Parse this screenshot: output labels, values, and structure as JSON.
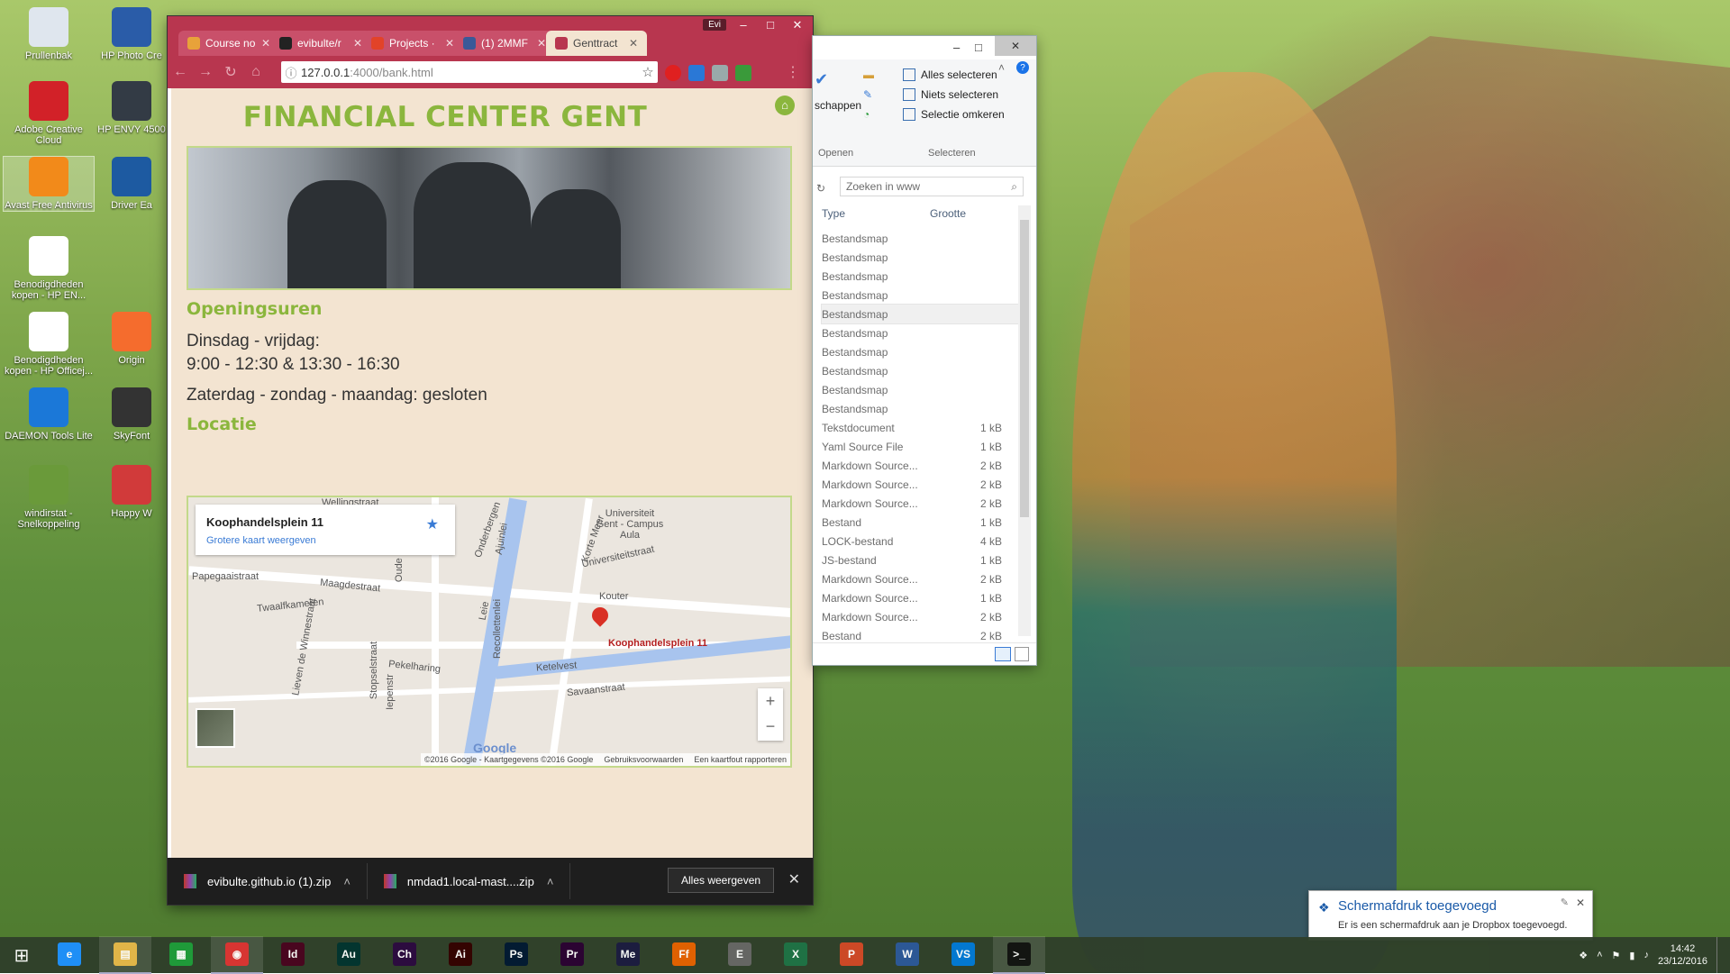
{
  "desktop_icons": [
    {
      "label": "Prullenbak",
      "color": "#dfe6ee"
    },
    {
      "label": "HP Photo Cre",
      "color": "#2a5ca8"
    },
    {
      "label": "Adobe Creative Cloud",
      "color": "#d22128"
    },
    {
      "label": "HP ENVY 4500",
      "color": "#333b45"
    },
    {
      "label": "Avast Free Antivirus",
      "color": "#f28a1a"
    },
    {
      "label": "Driver Ea",
      "color": "#1d5aa1"
    },
    {
      "label": "Benodigdheden kopen - HP EN...",
      "color": "#ffffff"
    },
    {
      "label": "Benodigdheden kopen - HP Officej...",
      "color": "#ffffff"
    },
    {
      "label": "Origin",
      "color": "#f56c2d"
    },
    {
      "label": "DAEMON Tools Lite",
      "color": "#1b78d8"
    },
    {
      "label": "SkyFont",
      "color": "#333"
    },
    {
      "label": "windirstat - Snelkoppeling",
      "color": "#6a9a3a"
    },
    {
      "label": "Happy W",
      "color": "#d13a3a"
    }
  ],
  "browser": {
    "profile": "Evi",
    "tabs": [
      {
        "label": "Course no",
        "color": "#e8a23a"
      },
      {
        "label": "evibulte/r",
        "color": "#222"
      },
      {
        "label": "Projects ·",
        "color": "#e24329"
      },
      {
        "label": "(1) 2MMF",
        "color": "#3b5998"
      },
      {
        "label": "Genttract",
        "color": "#b8364f",
        "active": true
      }
    ],
    "url_host": "127.0.0.1",
    "url_path": ":4000/bank.html"
  },
  "page": {
    "title": "FINANCIAL CENTER GENT",
    "hours_heading": "Openingsuren",
    "hours_line1": "Dinsdag - vrijdag:",
    "hours_line2": "9:00 - 12:30 & 13:30 - 16:30",
    "hours_line3": "Zaterdag - zondag - maandag: gesloten",
    "location_heading": "Locatie",
    "map": {
      "place": "Koophandelsplein 11",
      "bigger_map": "Grotere kaart weergeven",
      "pin_label": "Koophandelsplein 11",
      "labels": [
        "Papegaaistraat",
        "Maagdestraat",
        "Twaalfkameren",
        "Onderbergen",
        "Kouter",
        "Ketelvest",
        "Pekelharing",
        "Savaanstraat",
        "Universiteit Gent - Campus Aula",
        "Universiteitstraat",
        "Korte Meer",
        "Recollettenlei",
        "Leie",
        "Stopselstraat",
        "Lieven de Winnestraat",
        "Oude Houtlei",
        "Wellingstraat",
        "Ajuinlei",
        "Iepenstr"
      ],
      "footer": [
        "©2016 Google - Kaartgegevens ©2016 Google",
        "Gebruiksvoorwaarden",
        "Een kaartfout rapporteren"
      ],
      "google": "Google"
    }
  },
  "downloads": {
    "items": [
      "evibulte.github.io (1).zip",
      "nmdad1.local-mast....zip"
    ],
    "show_all": "Alles weergeven"
  },
  "explorer": {
    "ribbon": {
      "schappen": "schappen",
      "openen": "Openen",
      "select_all": "Alles selecteren",
      "select_none": "Niets selecteren",
      "invert": "Selectie omkeren",
      "selecteren": "Selecteren"
    },
    "search_placeholder": "Zoeken in www",
    "col_type": "Type",
    "col_size": "Grootte",
    "rows": [
      {
        "type": "Bestandsmap",
        "size": ""
      },
      {
        "type": "Bestandsmap",
        "size": ""
      },
      {
        "type": "Bestandsmap",
        "size": ""
      },
      {
        "type": "Bestandsmap",
        "size": ""
      },
      {
        "type": "Bestandsmap",
        "size": ""
      },
      {
        "type": "Bestandsmap",
        "size": ""
      },
      {
        "type": "Bestandsmap",
        "size": ""
      },
      {
        "type": "Bestandsmap",
        "size": ""
      },
      {
        "type": "Bestandsmap",
        "size": ""
      },
      {
        "type": "Bestandsmap",
        "size": ""
      },
      {
        "type": "Tekstdocument",
        "size": "1 kB"
      },
      {
        "type": "Yaml Source File",
        "size": "1 kB"
      },
      {
        "type": "Markdown Source...",
        "size": "2 kB"
      },
      {
        "type": "Markdown Source...",
        "size": "2 kB"
      },
      {
        "type": "Markdown Source...",
        "size": "2 kB"
      },
      {
        "type": "Bestand",
        "size": "1 kB"
      },
      {
        "type": "LOCK-bestand",
        "size": "4 kB"
      },
      {
        "type": "JS-bestand",
        "size": "1 kB"
      },
      {
        "type": "Markdown Source...",
        "size": "2 kB"
      },
      {
        "type": "Markdown Source...",
        "size": "1 kB"
      },
      {
        "type": "Markdown Source...",
        "size": "2 kB"
      },
      {
        "type": "Bestand",
        "size": "2 kB"
      }
    ]
  },
  "notification": {
    "title": "Schermafdruk toegevoegd",
    "text": "Er is een schermafdruk aan je Dropbox toegevoegd."
  },
  "taskbar": {
    "apps": [
      {
        "name": "ie",
        "label": "e",
        "color": "#1e90ff"
      },
      {
        "name": "explorer",
        "label": "▤",
        "color": "#e6b84a",
        "open": true
      },
      {
        "name": "store",
        "label": "▦",
        "color": "#1e9c3a"
      },
      {
        "name": "chrome",
        "label": "◉",
        "color": "#d33",
        "open": true
      },
      {
        "name": "indesign",
        "label": "Id",
        "color": "#49021f"
      },
      {
        "name": "audition",
        "label": "Au",
        "color": "#00332f"
      },
      {
        "name": "character",
        "label": "Ch",
        "color": "#2b0840"
      },
      {
        "name": "illustrator",
        "label": "Ai",
        "color": "#330000"
      },
      {
        "name": "photoshop",
        "label": "Ps",
        "color": "#001833"
      },
      {
        "name": "premiere",
        "label": "Pr",
        "color": "#2a0033"
      },
      {
        "name": "media-encoder",
        "label": "Me",
        "color": "#1a1a40"
      },
      {
        "name": "firefox",
        "label": "Ff",
        "color": "#e66000"
      },
      {
        "name": "evernote",
        "label": "E",
        "color": "#666"
      },
      {
        "name": "excel",
        "label": "X",
        "color": "#1e7145"
      },
      {
        "name": "powerpoint",
        "label": "P",
        "color": "#d24726"
      },
      {
        "name": "word",
        "label": "W",
        "color": "#2b579a"
      },
      {
        "name": "vscode",
        "label": "VS",
        "color": "#0078d7"
      },
      {
        "name": "cmd",
        "label": ">_",
        "color": "#111",
        "open": true
      }
    ],
    "time": "14:42",
    "date": "23/12/2016"
  }
}
